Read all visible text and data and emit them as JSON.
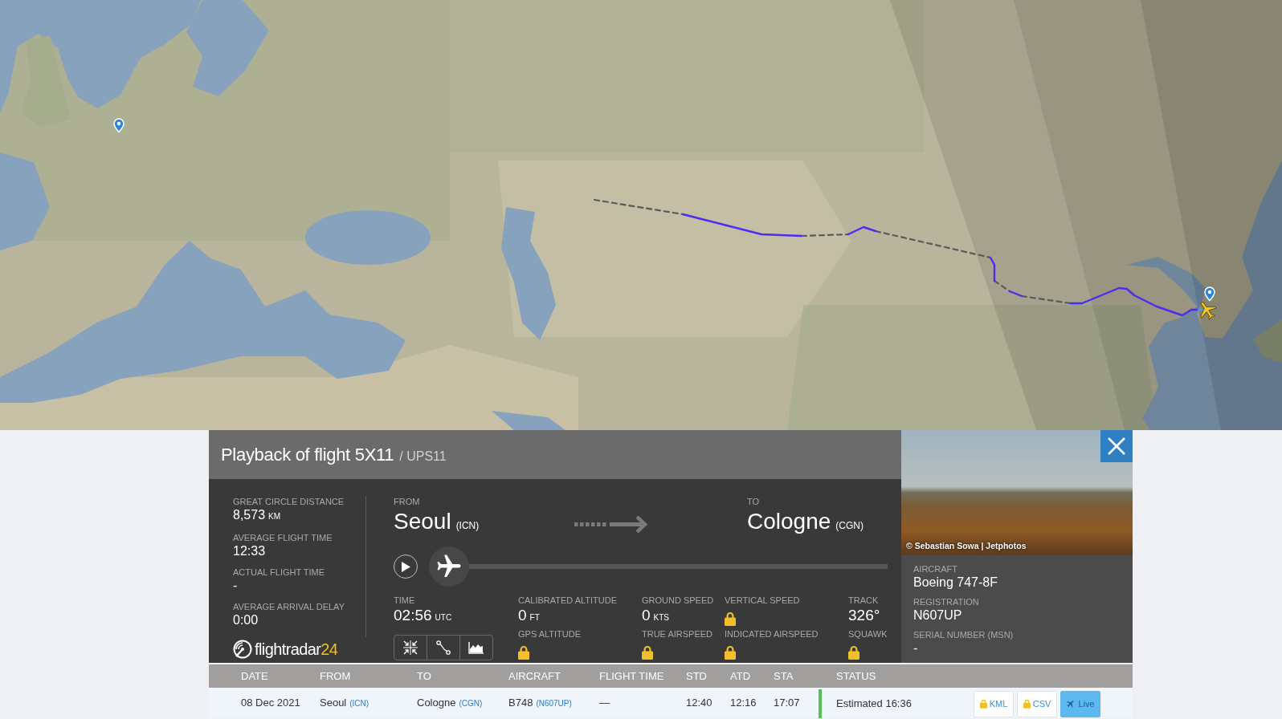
{
  "flight": {
    "title": "Playback of flight 5X11",
    "callsign": "/ UPS11"
  },
  "stats": [
    {
      "label": "GREAT CIRCLE DISTANCE",
      "value": "8,573",
      "unit": "KM"
    },
    {
      "label": "AVERAGE FLIGHT TIME",
      "value": "12:33"
    },
    {
      "label": "ACTUAL FLIGHT TIME",
      "value": "-"
    },
    {
      "label": "AVERAGE ARRIVAL DELAY",
      "value": "0:00"
    }
  ],
  "logo": {
    "text": "flightradar",
    "accent": "24"
  },
  "route": {
    "from": {
      "label": "FROM",
      "city": "Seoul",
      "code": "(ICN)"
    },
    "to": {
      "label": "TO",
      "city": "Cologne",
      "code": "(CGN)"
    }
  },
  "playback": {
    "playing": false,
    "level": 0
  },
  "time": {
    "label": "TIME",
    "value": "02:56",
    "unit": "UTC"
  },
  "telemetry": [
    {
      "label": "CALIBRATED ALTITUDE",
      "value": "0",
      "unit": "FT",
      "locked": false
    },
    {
      "label": "GROUND SPEED",
      "value": "0",
      "unit": "KTS",
      "locked": false
    },
    {
      "label": "VERTICAL SPEED",
      "locked": true
    },
    {
      "label": "TRACK",
      "value": "326°",
      "locked": false
    },
    {
      "label": "GPS ALTITUDE",
      "locked": true
    },
    {
      "label": "TRUE AIRSPEED",
      "locked": true
    },
    {
      "label": "INDICATED AIRSPEED",
      "locked": true
    },
    {
      "label": "SQUAWK",
      "locked": true
    }
  ],
  "aircraft": {
    "credit": "© Sebastian Sowa | Jetphotos",
    "details": [
      {
        "label": "AIRCRAFT",
        "value": "Boeing 747-8F"
      },
      {
        "label": "REGISTRATION",
        "value": "N607UP"
      },
      {
        "label": "SERIAL NUMBER (MSN)",
        "value": "-"
      }
    ]
  },
  "table": {
    "columns": [
      "DATE",
      "FROM",
      "TO",
      "AIRCRAFT",
      "FLIGHT TIME",
      "STD",
      "ATD",
      "STA",
      "STATUS"
    ],
    "rows": [
      {
        "date": "08 Dec 2021",
        "from": "Seoul",
        "from_code": "(ICN)",
        "to": "Cologne",
        "to_code": "(CGN)",
        "aircraft": "B748",
        "registration": "(N607UP)",
        "flight_time": "—",
        "std": "12:40",
        "atd": "12:16",
        "sta": "17:07",
        "status": "Estimated 16:36",
        "color": "#54c15a",
        "actions": [
          {
            "kind": "export",
            "label": "KML",
            "locked": true
          },
          {
            "kind": "export",
            "label": "CSV",
            "locked": true
          },
          {
            "kind": "live",
            "label": "Live",
            "locked": false
          }
        ]
      }
    ]
  }
}
